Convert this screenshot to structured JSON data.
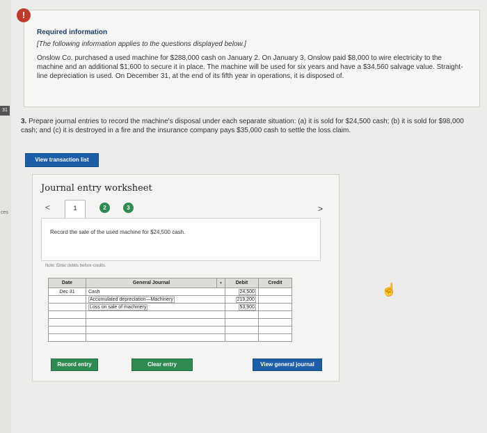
{
  "margin": {
    "tag1": "31",
    "tag2": "ces"
  },
  "alert": {
    "glyph": "!"
  },
  "info": {
    "title": "Required information",
    "note": "[The following information applies to the questions displayed below.]",
    "text": "Onslow Co. purchased a used machine for $288,000 cash on January 2. On January 3, Onslow paid $8,000 to wire electricity to the machine and an additional $1,600 to secure it in place. The machine will be used for six years and have a $34,560 salvage value. Straight-line depreciation is used. On December 31, at the end of its fifth year in operations, it is disposed of."
  },
  "question": {
    "number": "3.",
    "text": "Prepare journal entries to record the machine's disposal under each separate situation: (a) it is sold for $24,500 cash; (b) it is sold for $98,000 cash; and (c) it is destroyed in a fire and the insurance company pays $35,000 cash to settle the loss claim."
  },
  "buttons": {
    "view_transaction_list": "View transaction list",
    "record_entry": "Record entry",
    "clear_entry": "Clear entry",
    "view_general_journal": "View general journal"
  },
  "worksheet": {
    "title": "Journal entry worksheet",
    "prev": "<",
    "next": ">",
    "tabs": [
      "1",
      "2",
      "3"
    ],
    "instruction": "Record the sale of the used machine for $24,500 cash.",
    "note": "Note: Enter debits before credits."
  },
  "journal": {
    "headers": {
      "date": "Date",
      "account": "General Journal",
      "debit": "Debit",
      "credit": "Credit"
    },
    "rows": [
      {
        "date": "Dec 31",
        "account": "Cash",
        "debit": "24,500",
        "credit": ""
      },
      {
        "date": "",
        "account": "Accumulated depreciation—Machinery",
        "debit": "219,200",
        "credit": ""
      },
      {
        "date": "",
        "account": "Loss on sale of machinery",
        "debit": "53,900",
        "credit": ""
      },
      {
        "date": "",
        "account": "",
        "debit": "",
        "credit": ""
      },
      {
        "date": "",
        "account": "",
        "debit": "",
        "credit": ""
      },
      {
        "date": "",
        "account": "",
        "debit": "",
        "credit": ""
      },
      {
        "date": "",
        "account": "",
        "debit": "",
        "credit": ""
      }
    ]
  },
  "colors": {
    "primary_blue": "#1d5ea8",
    "green": "#2f8a52",
    "alert_red": "#c0392b"
  },
  "icons": {
    "alert": "exclamation-icon",
    "cursor": "pointer-cursor-icon",
    "dropdown": "dropdown-arrow-icon"
  }
}
